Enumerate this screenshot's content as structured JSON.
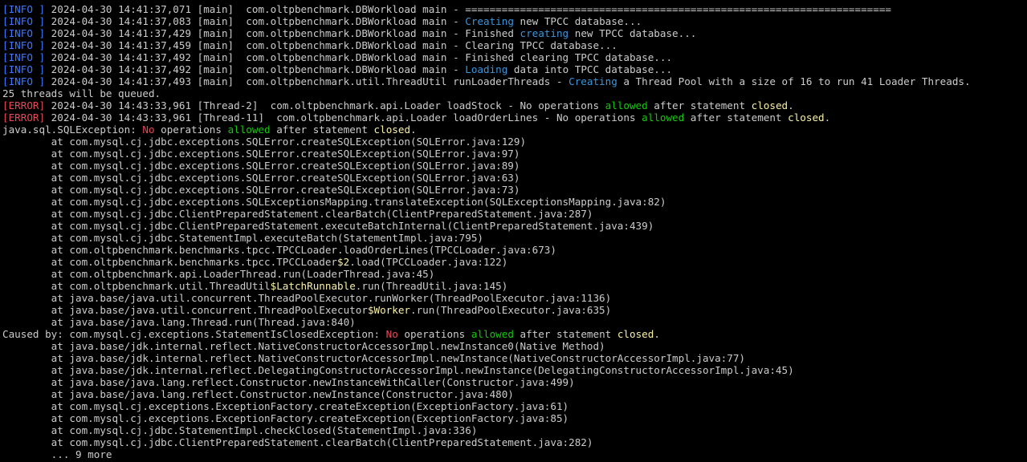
{
  "terminal": {
    "colors": {
      "background": "#000000",
      "plain": "#cccccc",
      "info": "#3b78ff",
      "error": "#e74856",
      "cyan": "#3a96dd",
      "red": "#e74856",
      "green": "#16c60c",
      "yellow": "#f9f1a5"
    },
    "lines": [
      [
        [
          "info",
          "[INFO ]"
        ],
        [
          "plain",
          " 2024-04-30 14:41:37,071 [main]  com.oltpbenchmark.DBWorkload main - ======================================================================"
        ]
      ],
      [
        [
          "info",
          "[INFO ]"
        ],
        [
          "plain",
          " 2024-04-30 14:41:37,083 [main]  com.oltpbenchmark.DBWorkload main - "
        ],
        [
          "cyan",
          "Creating"
        ],
        [
          "plain",
          " new TPCC database..."
        ]
      ],
      [
        [
          "info",
          "[INFO ]"
        ],
        [
          "plain",
          " 2024-04-30 14:41:37,429 [main]  com.oltpbenchmark.DBWorkload main - Finished "
        ],
        [
          "cyan",
          "creating"
        ],
        [
          "plain",
          " new TPCC database..."
        ]
      ],
      [
        [
          "info",
          "[INFO ]"
        ],
        [
          "plain",
          " 2024-04-30 14:41:37,459 [main]  com.oltpbenchmark.DBWorkload main - Clearing TPCC database..."
        ]
      ],
      [
        [
          "info",
          "[INFO ]"
        ],
        [
          "plain",
          " 2024-04-30 14:41:37,492 [main]  com.oltpbenchmark.DBWorkload main - Finished clearing TPCC database..."
        ]
      ],
      [
        [
          "info",
          "[INFO ]"
        ],
        [
          "plain",
          " 2024-04-30 14:41:37,492 [main]  com.oltpbenchmark.DBWorkload main - "
        ],
        [
          "cyan",
          "Loading"
        ],
        [
          "plain",
          " data into TPCC database..."
        ]
      ],
      [
        [
          "info",
          "[INFO ]"
        ],
        [
          "plain",
          " 2024-04-30 14:41:37,493 [main]  com.oltpbenchmark.util.ThreadUtil runLoaderThreads - "
        ],
        [
          "cyan",
          "Creating"
        ],
        [
          "plain",
          " a Thread Pool with a size of 16 to run 41 Loader Threads."
        ]
      ],
      [
        [
          "plain",
          "25 threads will be queued."
        ]
      ],
      [
        [
          "error",
          "[ERROR]"
        ],
        [
          "plain",
          " 2024-04-30 14:43:33,961 [Thread-2]  com.oltpbenchmark.api.Loader loadStock - No operations "
        ],
        [
          "green",
          "allowed"
        ],
        [
          "plain",
          " after statement "
        ],
        [
          "yellow",
          "closed"
        ],
        [
          "plain",
          "."
        ]
      ],
      [
        [
          "error",
          "[ERROR]"
        ],
        [
          "plain",
          " 2024-04-30 14:43:33,961 [Thread-11]  com.oltpbenchmark.api.Loader loadOrderLines - No operations "
        ],
        [
          "green",
          "allowed"
        ],
        [
          "plain",
          " after statement "
        ],
        [
          "yellow",
          "closed"
        ],
        [
          "plain",
          "."
        ]
      ],
      [
        [
          "plain",
          "java.sql.SQLException: "
        ],
        [
          "red",
          "No"
        ],
        [
          "plain",
          " operations "
        ],
        [
          "green",
          "allowed"
        ],
        [
          "plain",
          " after statement "
        ],
        [
          "yellow",
          "closed"
        ],
        [
          "plain",
          "."
        ]
      ],
      [
        [
          "plain",
          "        at com.mysql.cj.jdbc.exceptions.SQLError.createSQLException(SQLError.java:129)"
        ]
      ],
      [
        [
          "plain",
          "        at com.mysql.cj.jdbc.exceptions.SQLError.createSQLException(SQLError.java:97)"
        ]
      ],
      [
        [
          "plain",
          "        at com.mysql.cj.jdbc.exceptions.SQLError.createSQLException(SQLError.java:89)"
        ]
      ],
      [
        [
          "plain",
          "        at com.mysql.cj.jdbc.exceptions.SQLError.createSQLException(SQLError.java:63)"
        ]
      ],
      [
        [
          "plain",
          "        at com.mysql.cj.jdbc.exceptions.SQLError.createSQLException(SQLError.java:73)"
        ]
      ],
      [
        [
          "plain",
          "        at com.mysql.cj.jdbc.exceptions.SQLExceptionsMapping.translateException(SQLExceptionsMapping.java:82)"
        ]
      ],
      [
        [
          "plain",
          "        at com.mysql.cj.jdbc.ClientPreparedStatement.clearBatch(ClientPreparedStatement.java:287)"
        ]
      ],
      [
        [
          "plain",
          "        at com.mysql.cj.jdbc.ClientPreparedStatement.executeBatchInternal(ClientPreparedStatement.java:439)"
        ]
      ],
      [
        [
          "plain",
          "        at com.mysql.cj.jdbc.StatementImpl.executeBatch(StatementImpl.java:795)"
        ]
      ],
      [
        [
          "plain",
          "        at com.oltpbenchmark.benchmarks.tpcc.TPCCLoader.loadOrderLines(TPCCLoader.java:673)"
        ]
      ],
      [
        [
          "plain",
          "        at com.oltpbenchmark.benchmarks.tpcc.TPCCLoader"
        ],
        [
          "yellow",
          "$2"
        ],
        [
          "plain",
          ".load(TPCCLoader.java:122)"
        ]
      ],
      [
        [
          "plain",
          "        at com.oltpbenchmark.api.LoaderThread.run(LoaderThread.java:45)"
        ]
      ],
      [
        [
          "plain",
          "        at com.oltpbenchmark.util.ThreadUtil"
        ],
        [
          "yellow",
          "$LatchRunnable"
        ],
        [
          "plain",
          ".run(ThreadUtil.java:145)"
        ]
      ],
      [
        [
          "plain",
          "        at java.base/java.util.concurrent.ThreadPoolExecutor.runWorker(ThreadPoolExecutor.java:1136)"
        ]
      ],
      [
        [
          "plain",
          "        at java.base/java.util.concurrent.ThreadPoolExecutor"
        ],
        [
          "yellow",
          "$Worker"
        ],
        [
          "plain",
          ".run(ThreadPoolExecutor.java:635)"
        ]
      ],
      [
        [
          "plain",
          "        at java.base/java.lang.Thread.run(Thread.java:840)"
        ]
      ],
      [
        [
          "plain",
          "Caused by: com.mysql.cj.exceptions.StatementIsClosedException: "
        ],
        [
          "red",
          "No"
        ],
        [
          "plain",
          " operations "
        ],
        [
          "green",
          "allowed"
        ],
        [
          "plain",
          " after statement "
        ],
        [
          "yellow",
          "closed"
        ],
        [
          "plain",
          "."
        ]
      ],
      [
        [
          "plain",
          "        at java.base/jdk.internal.reflect.NativeConstructorAccessorImpl.newInstance0(Native Method)"
        ]
      ],
      [
        [
          "plain",
          "        at java.base/jdk.internal.reflect.NativeConstructorAccessorImpl.newInstance(NativeConstructorAccessorImpl.java:77)"
        ]
      ],
      [
        [
          "plain",
          "        at java.base/jdk.internal.reflect.DelegatingConstructorAccessorImpl.newInstance(DelegatingConstructorAccessorImpl.java:45)"
        ]
      ],
      [
        [
          "plain",
          "        at java.base/java.lang.reflect.Constructor.newInstanceWithCaller(Constructor.java:499)"
        ]
      ],
      [
        [
          "plain",
          "        at java.base/java.lang.reflect.Constructor.newInstance(Constructor.java:480)"
        ]
      ],
      [
        [
          "plain",
          "        at com.mysql.cj.exceptions.ExceptionFactory.createException(ExceptionFactory.java:61)"
        ]
      ],
      [
        [
          "plain",
          "        at com.mysql.cj.exceptions.ExceptionFactory.createException(ExceptionFactory.java:85)"
        ]
      ],
      [
        [
          "plain",
          "        at com.mysql.cj.jdbc.StatementImpl.checkClosed(StatementImpl.java:336)"
        ]
      ],
      [
        [
          "plain",
          "        at com.mysql.cj.jdbc.ClientPreparedStatement.clearBatch(ClientPreparedStatement.java:282)"
        ]
      ],
      [
        [
          "plain",
          "        ... 9 more"
        ]
      ]
    ]
  }
}
